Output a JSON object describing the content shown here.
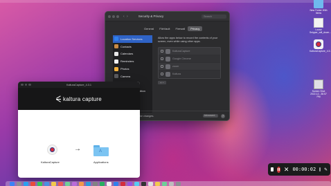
{
  "security_window": {
    "title": "Security & Privacy",
    "nav_arrows": "‹ ›",
    "search_placeholder": "Search",
    "tabs": [
      {
        "label": "General",
        "active": false
      },
      {
        "label": "FileVault",
        "active": false
      },
      {
        "label": "Firewall",
        "active": false
      },
      {
        "label": "Privacy",
        "active": true
      }
    ],
    "privacy_list": [
      {
        "label": "Location Services",
        "icon": "location-arrow-icon",
        "color": "#2f80ed",
        "selected": true
      },
      {
        "label": "Contacts",
        "icon": "contacts-icon",
        "color": "#c98a44",
        "selected": false
      },
      {
        "label": "Calendars",
        "icon": "calendar-icon",
        "color": "#e8e8e8",
        "selected": false
      },
      {
        "label": "Reminders",
        "icon": "reminders-icon",
        "color": "#f0f0f0",
        "selected": false
      },
      {
        "label": "Photos",
        "icon": "photos-icon",
        "color": "#f3b13c",
        "selected": false
      },
      {
        "label": "Camera",
        "icon": "camera-icon",
        "color": "#5a5a5e",
        "selected": false
      },
      {
        "label": "Microphone",
        "icon": "microphone-icon",
        "color": "#5a5a5e",
        "selected": false
      },
      {
        "label": "Speech Recognition",
        "icon": "speech-recognition-icon",
        "color": "#6a6a6e",
        "selected": false
      },
      {
        "label": "Accessibility",
        "icon": "accessibility-icon",
        "color": "#2f6fd6",
        "selected": false
      }
    ],
    "description": "Allow the apps below to record the contents of your screen, even while using other apps.",
    "apps": [
      {
        "name": "KalturaCapture",
        "checked": false
      },
      {
        "name": "Google Chrome",
        "checked": false
      },
      {
        "name": "zoom",
        "checked": false
      },
      {
        "name": "Kaltura",
        "checked": false
      }
    ],
    "add_remove": "+ −",
    "footer_text": "Click the lock to make changes.",
    "advanced_label": "Advanced...",
    "help_label": "?"
  },
  "kaltura_window": {
    "title": "KalturaCapture_4.3.1",
    "brand": "kaltura capture",
    "app_label": "KalturaCapture",
    "arrow": "→",
    "folder_label": "Applications",
    "folder_mark": "A"
  },
  "desktop_icons": [
    {
      "label": "New Folder With Items",
      "kind": "folder"
    },
    {
      "label": "Loose Snipper_will_down...",
      "kind": "file"
    },
    {
      "label": "KalturaCapture_4.3.1",
      "kind": "kaltura"
    },
    {
      "label": "Screen Shot 2022-12...38.57 PM",
      "kind": "screenshot"
    }
  ],
  "recording_bar": {
    "timer": "00:00:02",
    "cancel": "✕",
    "pen": "✎"
  },
  "colors": {
    "accent_blue": "#2f63c6",
    "record_red": "#d23a3a"
  }
}
